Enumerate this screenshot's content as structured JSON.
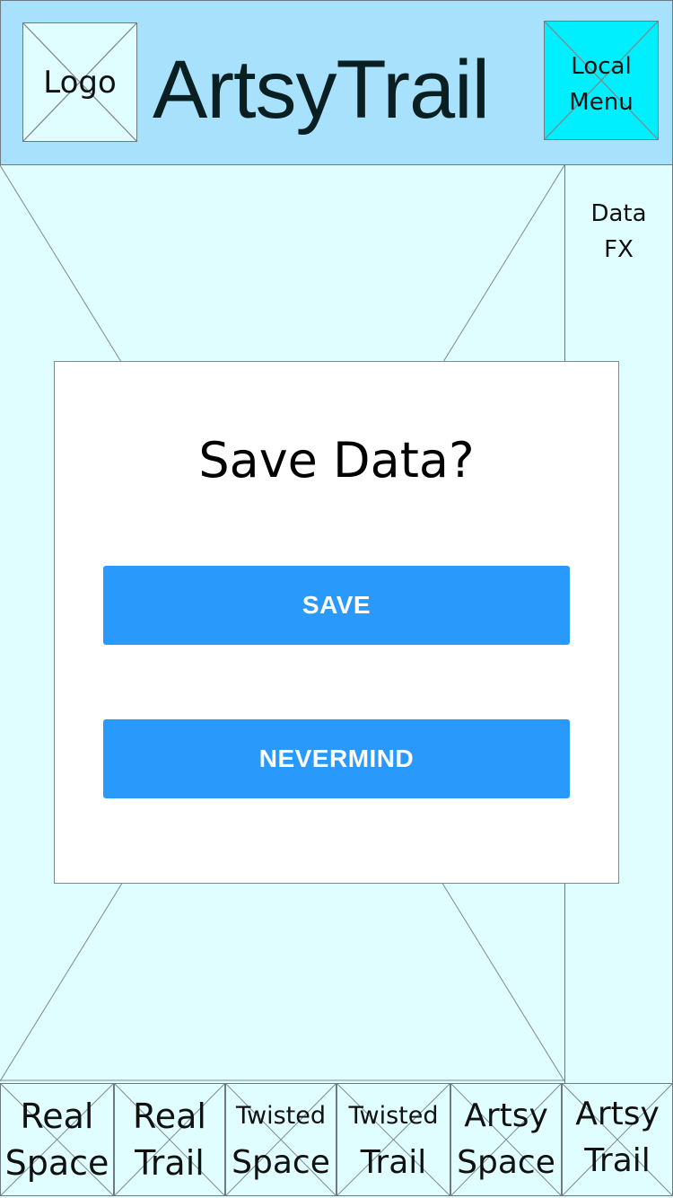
{
  "header": {
    "logo_label": "Logo",
    "title": "ArtsyTrail",
    "menu_line1": "Local",
    "menu_line2": "Menu"
  },
  "side_panel": {
    "line1": "Data",
    "line2": "FX"
  },
  "dialog": {
    "title": "Save Data?",
    "save_label": "SAVE",
    "nevermind_label": "NEVERMIND"
  },
  "nav": {
    "items": [
      {
        "line1": "Real",
        "line2": "Space"
      },
      {
        "line1": "Real",
        "line2": "Trail"
      },
      {
        "line1": "Twisted",
        "line2": "Space"
      },
      {
        "line1": "Twisted",
        "line2": "Trail"
      },
      {
        "line1": "Artsy",
        "line2": "Space"
      },
      {
        "line1": "Artsy",
        "line2": "Trail"
      }
    ]
  },
  "colors": {
    "header_bg": "#a8e1fc",
    "page_bg": "#e0feff",
    "menu_bg": "#00efff",
    "button_bg": "#2a99fc"
  }
}
